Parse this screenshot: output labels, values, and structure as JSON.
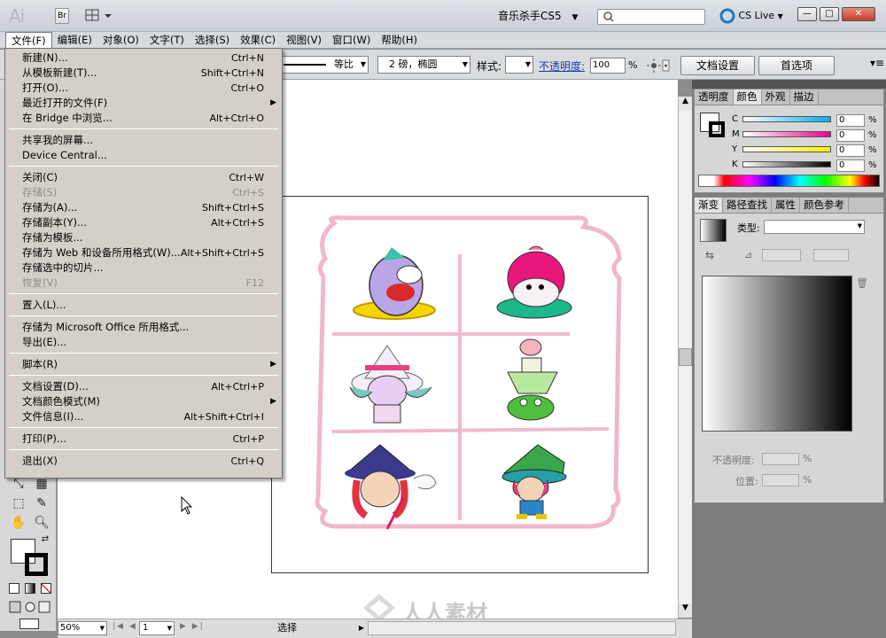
{
  "titlebar": {
    "logo": "Ai",
    "bridge": "Br",
    "workspace": "音乐杀手CS5",
    "cs_live": "CS Live",
    "min": "—",
    "max": "□",
    "close": "✕"
  },
  "menubar": [
    "文件(F)",
    "编辑(E)",
    "对象(O)",
    "文字(T)",
    "选择(S)",
    "效果(C)",
    "视图(V)",
    "窗口(W)",
    "帮助(H)"
  ],
  "control": {
    "stroke_profile": "等比",
    "brush": "2 磅，椭圆",
    "style_label": "样式:",
    "opacity_label": "不透明度:",
    "opacity_value": "100",
    "percent": "%",
    "doc_setup": "文档设置",
    "preferences": "首选项"
  },
  "file_menu": [
    {
      "label": "新建(N)...",
      "shortcut": "Ctrl+N"
    },
    {
      "label": "从模板新建(T)...",
      "shortcut": "Shift+Ctrl+N"
    },
    {
      "label": "打开(O)...",
      "shortcut": "Ctrl+O"
    },
    {
      "label": "最近打开的文件(F)",
      "shortcut": "",
      "submenu": true
    },
    {
      "label": "在 Bridge 中浏览...",
      "shortcut": "Alt+Ctrl+O"
    },
    {
      "sep": true
    },
    {
      "label": "共享我的屏幕...",
      "shortcut": ""
    },
    {
      "label": "Device Central...",
      "shortcut": ""
    },
    {
      "sep": true
    },
    {
      "label": "关闭(C)",
      "shortcut": "Ctrl+W"
    },
    {
      "label": "存储(S)",
      "shortcut": "Ctrl+S",
      "disabled": true
    },
    {
      "label": "存储为(A)...",
      "shortcut": "Shift+Ctrl+S"
    },
    {
      "label": "存储副本(Y)...",
      "shortcut": "Alt+Ctrl+S"
    },
    {
      "label": "存储为模板...",
      "shortcut": ""
    },
    {
      "label": "存储为 Web 和设备所用格式(W)...",
      "shortcut": "Alt+Shift+Ctrl+S"
    },
    {
      "label": "存储选中的切片...",
      "shortcut": ""
    },
    {
      "label": "恢复(V)",
      "shortcut": "F12",
      "disabled": true
    },
    {
      "sep": true
    },
    {
      "label": "置入(L)...",
      "shortcut": ""
    },
    {
      "sep": true
    },
    {
      "label": "存储为 Microsoft Office 所用格式...",
      "shortcut": ""
    },
    {
      "label": "导出(E)...",
      "shortcut": ""
    },
    {
      "sep": true
    },
    {
      "label": "脚本(R)",
      "shortcut": "",
      "submenu": true
    },
    {
      "sep": true
    },
    {
      "label": "文档设置(D)...",
      "shortcut": "Alt+Ctrl+P"
    },
    {
      "label": "文档颜色模式(M)",
      "shortcut": "",
      "submenu": true
    },
    {
      "label": "文件信息(I)...",
      "shortcut": "Alt+Shift+Ctrl+I"
    },
    {
      "sep": true
    },
    {
      "label": "打印(P)...",
      "shortcut": "Ctrl+P"
    },
    {
      "sep": true
    },
    {
      "label": "退出(X)",
      "shortcut": "Ctrl+Q"
    }
  ],
  "color_panel": {
    "tabs": [
      "透明度",
      "颜色",
      "外观",
      "描边"
    ],
    "channels": [
      "C",
      "M",
      "Y",
      "K"
    ],
    "values": [
      "0",
      "0",
      "0",
      "0"
    ],
    "percent": "%"
  },
  "gradient_panel": {
    "tabs": [
      "渐变",
      "路径查找",
      "属性",
      "颜色参考"
    ],
    "type_label": "类型:",
    "opacity_label": "不透明度:",
    "position_label": "位置:",
    "percent": "%"
  },
  "status": {
    "zoom": "50%",
    "page": "1",
    "mode": "选择"
  },
  "watermark": "人人素材"
}
